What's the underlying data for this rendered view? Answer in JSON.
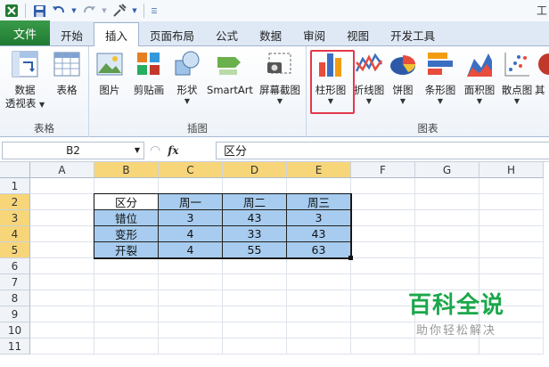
{
  "title_char": "工",
  "tabs": [
    "文件",
    "开始",
    "插入",
    "页面布局",
    "公式",
    "数据",
    "审阅",
    "视图",
    "开发工具"
  ],
  "ribbon": {
    "groups": {
      "tables": "表格",
      "illustrations": "插图",
      "charts": "图表"
    },
    "buttons": {
      "pivot_line1": "数据",
      "pivot_line2": "透视表",
      "table": "表格",
      "picture": "图片",
      "clipart": "剪贴画",
      "shapes": "形状",
      "smartart": "SmartArt",
      "screenshot": "屏幕截图",
      "column": "柱形图",
      "line": "折线图",
      "pie": "饼图",
      "bar": "条形图",
      "area": "面积图",
      "scatter": "散点图",
      "other": "其"
    }
  },
  "formula_bar": {
    "name_box": "B2",
    "fx": "fx",
    "formula": "区分"
  },
  "columns": [
    "A",
    "B",
    "C",
    "D",
    "E",
    "F",
    "G",
    "H"
  ],
  "rows": [
    "1",
    "2",
    "3",
    "4",
    "5",
    "6",
    "7",
    "8",
    "9",
    "10",
    "11"
  ],
  "table": {
    "header": [
      "区分",
      "周一",
      "周二",
      "周三"
    ],
    "rows": [
      [
        "错位",
        "3",
        "43",
        "3"
      ],
      [
        "变形",
        "4",
        "33",
        "43"
      ],
      [
        "开裂",
        "4",
        "55",
        "63"
      ]
    ]
  },
  "watermark": {
    "title": "百科全说",
    "subtitle": "助你轻松解决"
  },
  "colors": {
    "file_tab": "#1f7a32",
    "selected_header": "#f7d67a",
    "table_fill": "#a7ccef",
    "highlight": "#e2394a",
    "watermark": "#1aa84a"
  }
}
